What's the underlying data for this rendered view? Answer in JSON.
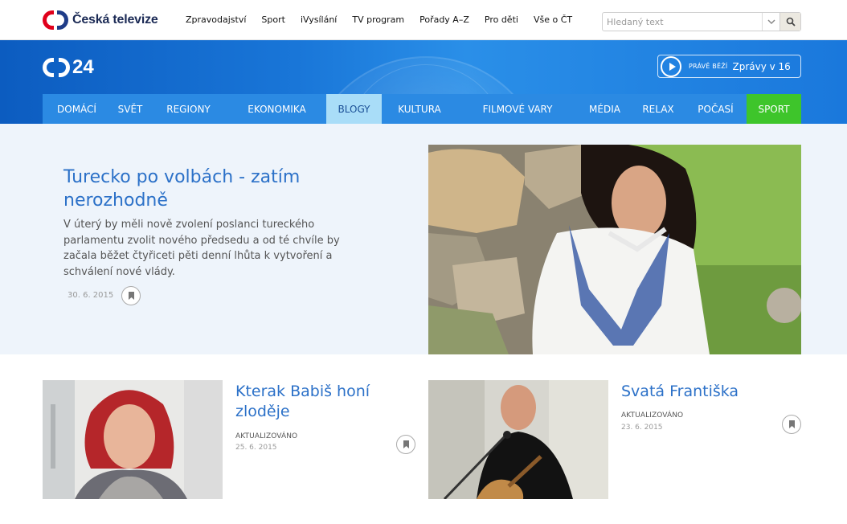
{
  "topbar": {
    "logo_text": "Česká televize",
    "nav": [
      "Zpravodajství",
      "Sport",
      "iVysílání",
      "TV program",
      "Pořady A–Z",
      "Pro děti",
      "Vše o ČT"
    ],
    "search_placeholder": "Hledaný text"
  },
  "header": {
    "logo_number": "24",
    "live_label": "PRÁVĚ BĚŽÍ",
    "live_program": "Zprávy v 16"
  },
  "mainnav": {
    "items": [
      "DOMÁCÍ",
      "SVĚT",
      "REGIONY",
      "EKONOMIKA",
      "BLOGY",
      "KULTURA",
      "FILMOVÉ VARY",
      "MÉDIA",
      "RELAX",
      "POČASÍ",
      "SPORT"
    ],
    "active": "BLOGY",
    "colors": {
      "nav_bg": "#2b8ae3",
      "active_bg": "#a9ddf8",
      "sport_bg": "#3ec52b"
    }
  },
  "hero": {
    "title": "Turecko po volbách - zatím nerozhodně",
    "text": "V úterý by měli nově zvolení poslanci tureckého parlamentu zvolit nového předsedu a od té chvíle by začala běžet čtyřiceti pěti denní lhůta k vytvoření a schválení nové vlády.",
    "date": "30. 6. 2015"
  },
  "cards": [
    {
      "title": "Kterak Babiš honí zloděje",
      "updated": "AKTUALIZOVÁNO",
      "date": "25. 6. 2015"
    },
    {
      "title": "Svatá Františka",
      "updated": "AKTUALIZOVÁNO",
      "date": "23. 6. 2015"
    }
  ]
}
